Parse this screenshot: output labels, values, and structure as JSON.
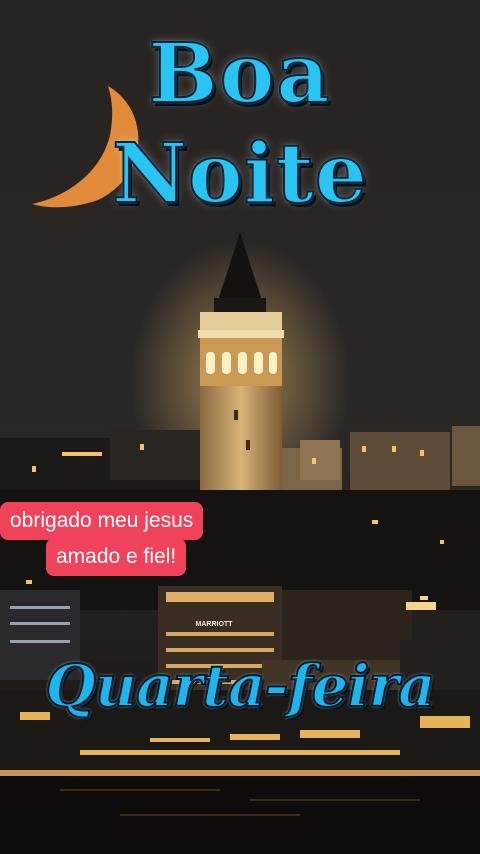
{
  "greeting": {
    "line1": "Boa",
    "line2": "Noite"
  },
  "caption": {
    "line1": "obrigado meu jesus",
    "line2": "amado e fiel!"
  },
  "weekday": "Quarta-feira",
  "sign": "MARRIOTT",
  "colors": {
    "title": "#29c4f2",
    "caption_bg": "#f0425a",
    "sky": "#2a2624",
    "moon": "#e08a3a"
  }
}
